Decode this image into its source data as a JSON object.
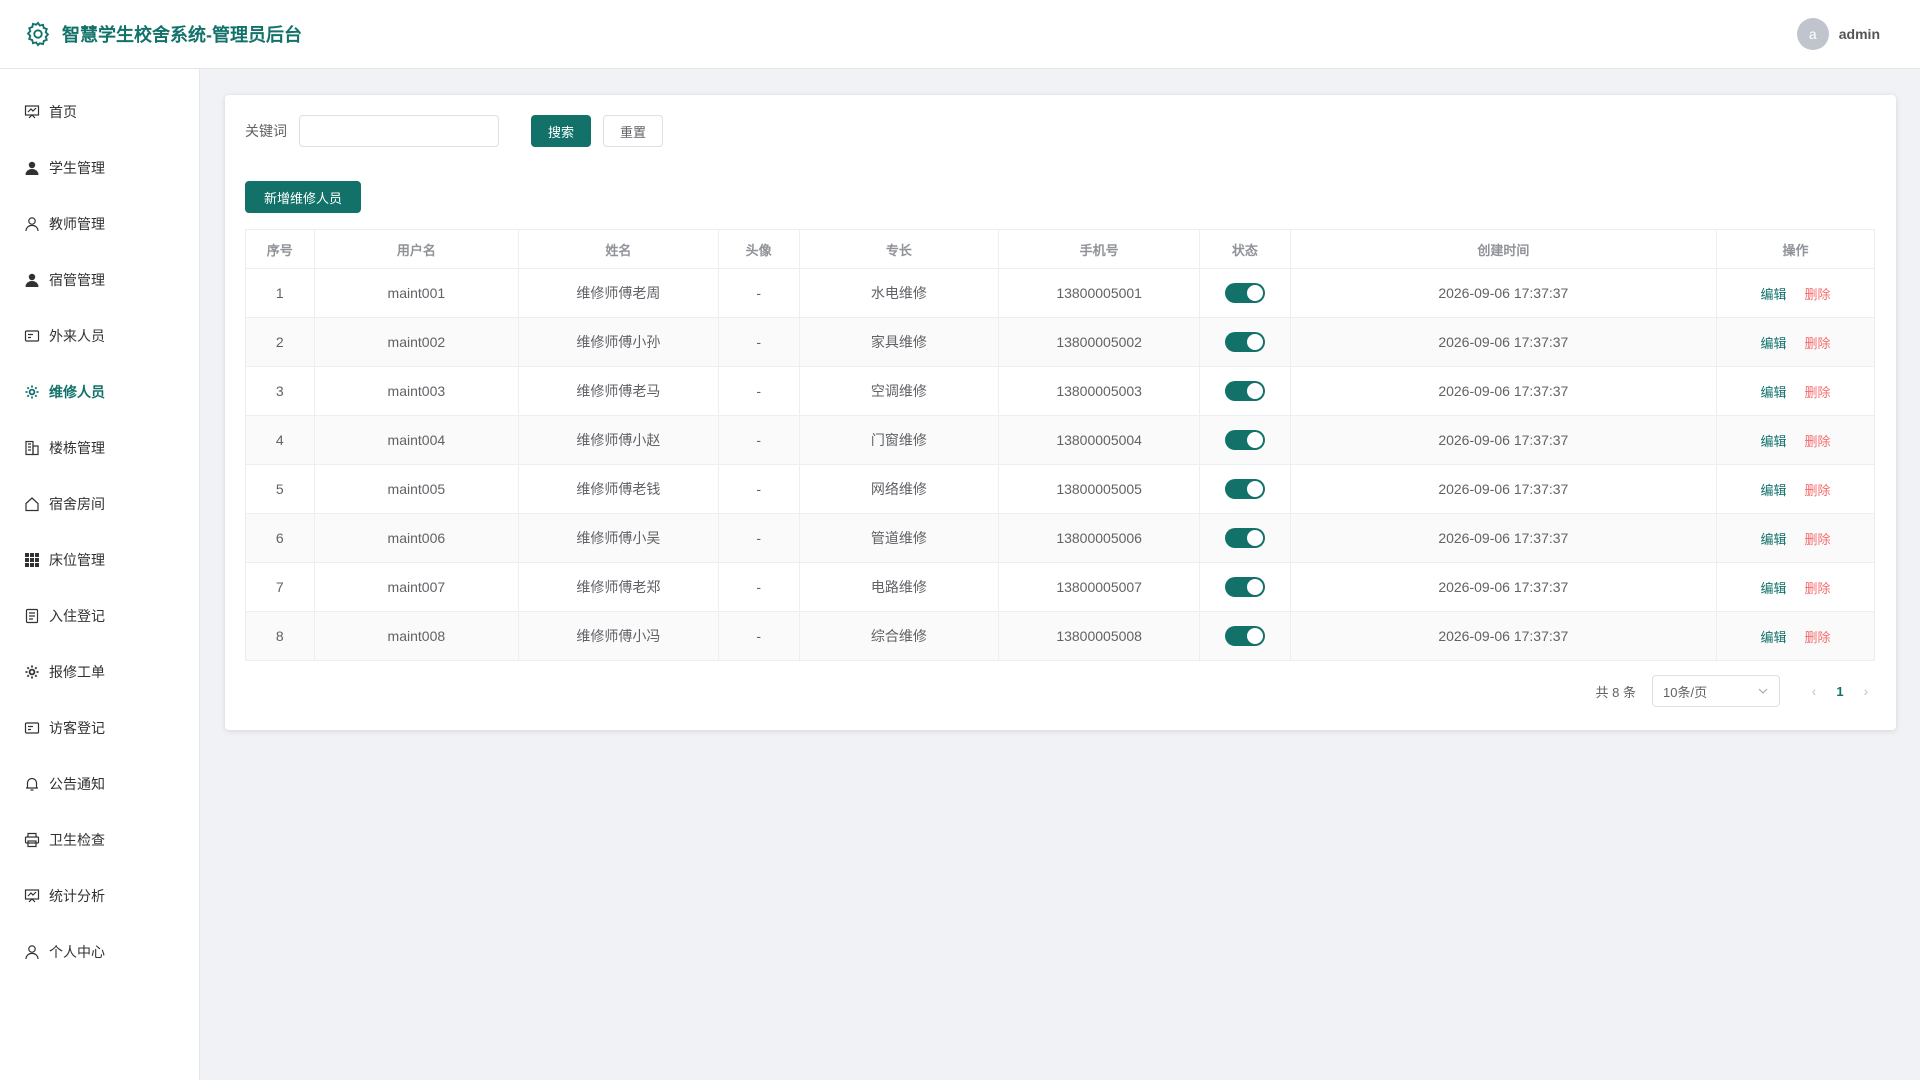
{
  "app": {
    "title": "智慧学生校舍系统-管理员后台",
    "user_initial": "a",
    "username": "admin"
  },
  "sidebar": {
    "items": [
      {
        "label": "首页",
        "icon": "dashboard-icon"
      },
      {
        "label": "学生管理",
        "icon": "user-filled-icon"
      },
      {
        "label": "教师管理",
        "icon": "user-icon"
      },
      {
        "label": "宿管管理",
        "icon": "user-filled-icon"
      },
      {
        "label": "外来人员",
        "icon": "id-card-icon"
      },
      {
        "label": "维修人员",
        "icon": "gear-icon"
      },
      {
        "label": "楼栋管理",
        "icon": "building-icon"
      },
      {
        "label": "宿舍房间",
        "icon": "house-icon"
      },
      {
        "label": "床位管理",
        "icon": "grid-icon"
      },
      {
        "label": "入住登记",
        "icon": "document-icon"
      },
      {
        "label": "报修工单",
        "icon": "gear-icon"
      },
      {
        "label": "访客登记",
        "icon": "id-card-icon"
      },
      {
        "label": "公告通知",
        "icon": "bell-icon"
      },
      {
        "label": "卫生检查",
        "icon": "printer-icon"
      },
      {
        "label": "统计分析",
        "icon": "dashboard-icon"
      },
      {
        "label": "个人中心",
        "icon": "user-icon"
      }
    ],
    "active_index": 5
  },
  "search": {
    "label": "关键词",
    "value": "",
    "placeholder": "",
    "search_button": "搜索",
    "reset_button": "重置"
  },
  "toolbar": {
    "add_button": "新增维修人员"
  },
  "table": {
    "columns": [
      "序号",
      "用户名",
      "姓名",
      "头像",
      "专长",
      "手机号",
      "状态",
      "创建时间",
      "操作"
    ],
    "edit_label": "编辑",
    "delete_label": "删除",
    "rows": [
      {
        "index": "1",
        "username": "maint001",
        "name": "维修师傅老周",
        "avatar": "-",
        "specialty": "水电维修",
        "phone": "13800005001",
        "status": true,
        "created": "2026-09-06 17:37:37"
      },
      {
        "index": "2",
        "username": "maint002",
        "name": "维修师傅小孙",
        "avatar": "-",
        "specialty": "家具维修",
        "phone": "13800005002",
        "status": true,
        "created": "2026-09-06 17:37:37"
      },
      {
        "index": "3",
        "username": "maint003",
        "name": "维修师傅老马",
        "avatar": "-",
        "specialty": "空调维修",
        "phone": "13800005003",
        "status": true,
        "created": "2026-09-06 17:37:37"
      },
      {
        "index": "4",
        "username": "maint004",
        "name": "维修师傅小赵",
        "avatar": "-",
        "specialty": "门窗维修",
        "phone": "13800005004",
        "status": true,
        "created": "2026-09-06 17:37:37"
      },
      {
        "index": "5",
        "username": "maint005",
        "name": "维修师傅老钱",
        "avatar": "-",
        "specialty": "网络维修",
        "phone": "13800005005",
        "status": true,
        "created": "2026-09-06 17:37:37"
      },
      {
        "index": "6",
        "username": "maint006",
        "name": "维修师傅小吴",
        "avatar": "-",
        "specialty": "管道维修",
        "phone": "13800005006",
        "status": true,
        "created": "2026-09-06 17:37:37"
      },
      {
        "index": "7",
        "username": "maint007",
        "name": "维修师傅老郑",
        "avatar": "-",
        "specialty": "电路维修",
        "phone": "13800005007",
        "status": true,
        "created": "2026-09-06 17:37:37"
      },
      {
        "index": "8",
        "username": "maint008",
        "name": "维修师傅小冯",
        "avatar": "-",
        "specialty": "综合维修",
        "phone": "13800005008",
        "status": true,
        "created": "2026-09-06 17:37:37"
      }
    ]
  },
  "pagination": {
    "total_text": "共 8 条",
    "page_size": "10条/页",
    "current_page": "1"
  },
  "colors": {
    "primary": "#12726a",
    "danger": "#f56c6c",
    "background": "#f0f2f5"
  }
}
